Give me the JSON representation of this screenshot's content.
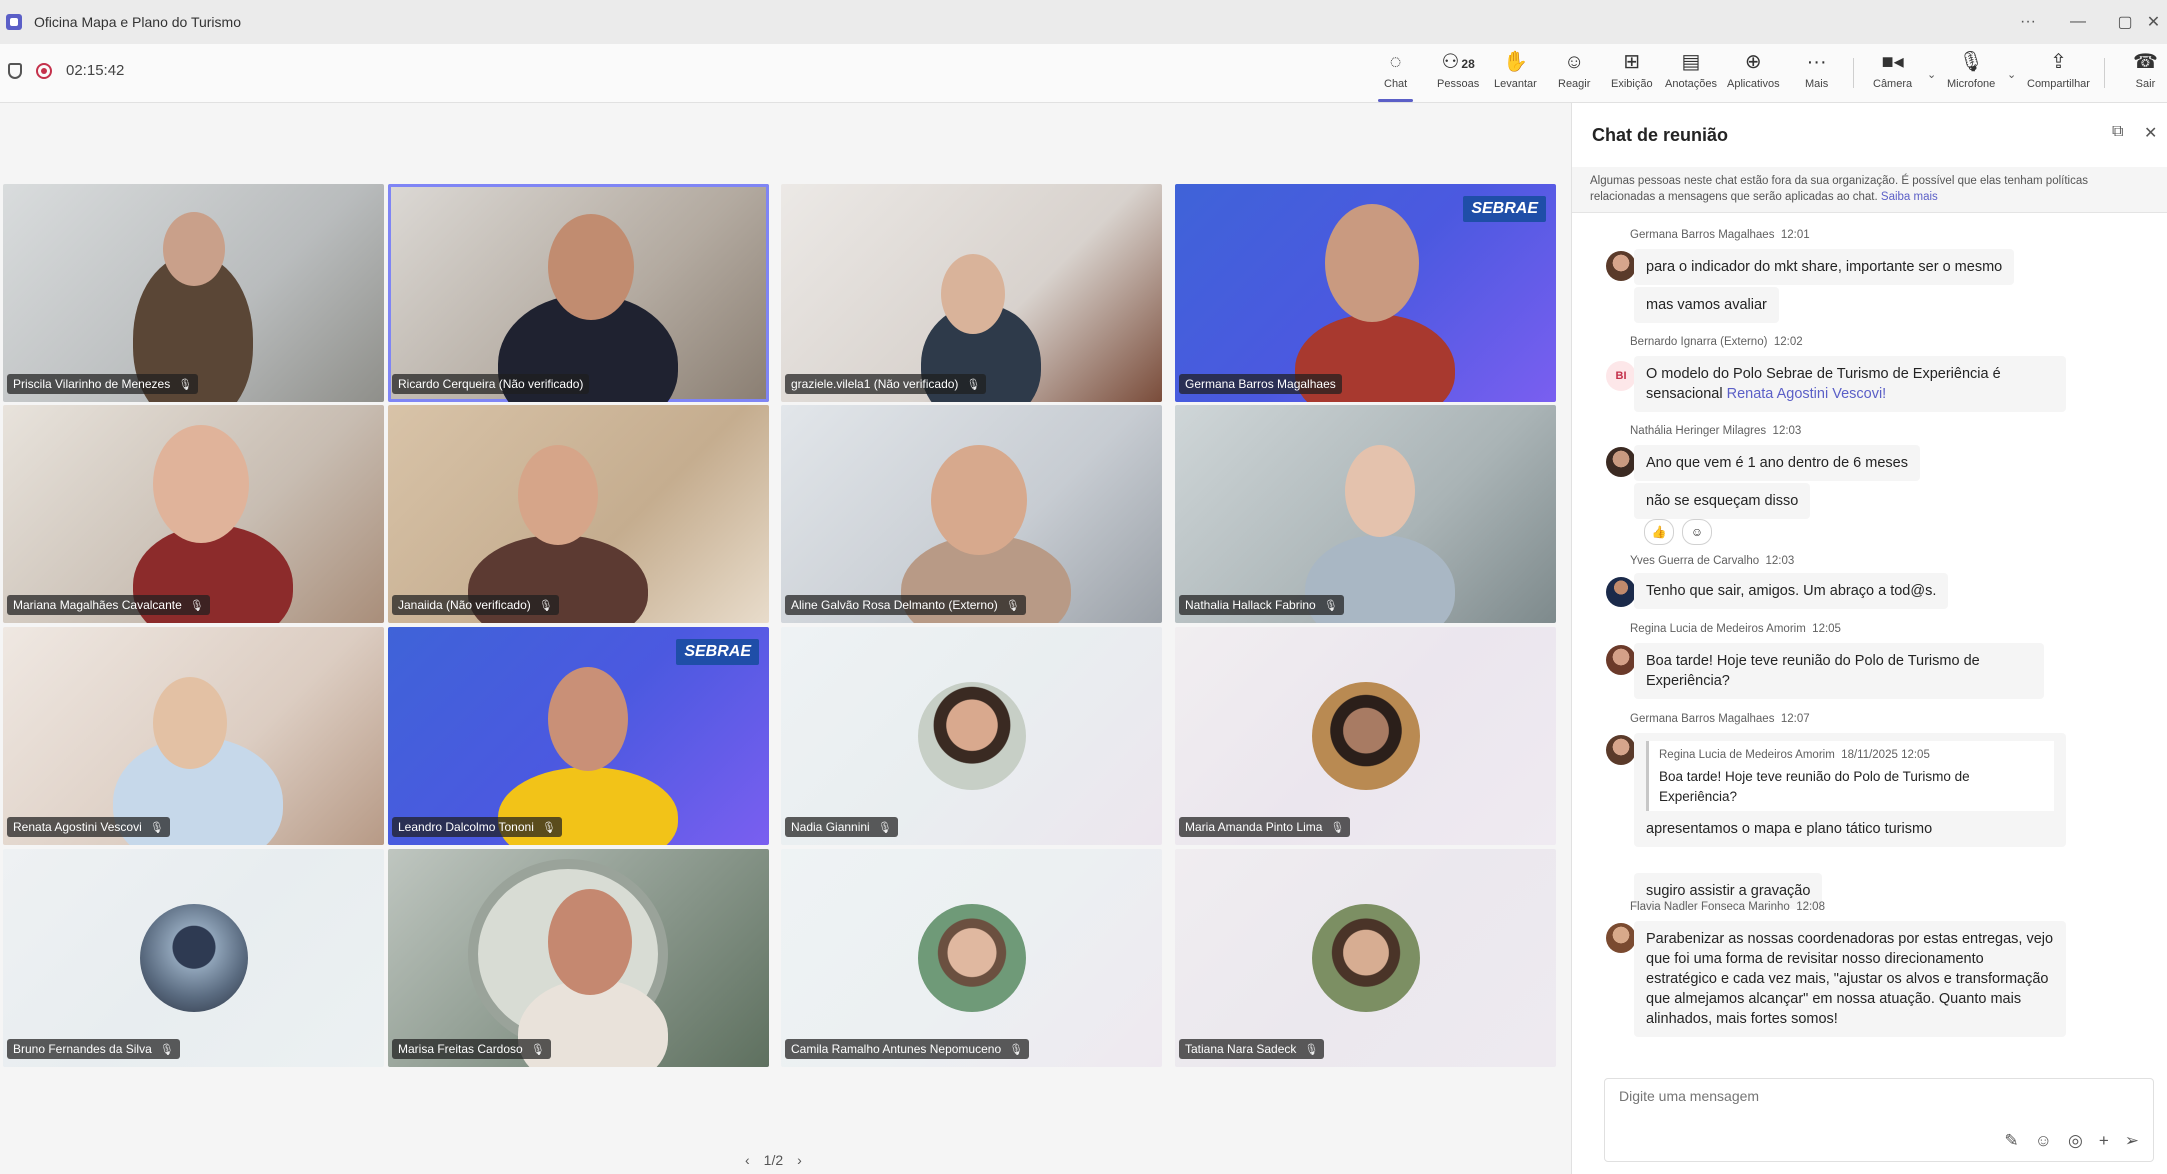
{
  "window": {
    "title": "Oficina Mapa e Plano do Turismo"
  },
  "meeting": {
    "elapsed": "02:15:42",
    "people_count": "28"
  },
  "toolbar": {
    "chat": "Chat",
    "people": "Pessoas",
    "raise": "Levantar",
    "react": "Reagir",
    "view": "Exibição",
    "notes": "Anotações",
    "apps": "Aplicativos",
    "more": "Mais",
    "camera": "Câmera",
    "mic": "Microfone",
    "share": "Compartilhar",
    "leave": "Sair"
  },
  "participants": [
    "Priscila Vilarinho de Menezes",
    "Ricardo Cerqueira (Não verificado)",
    "graziele.vilela1 (Não verificado)",
    "Germana Barros Magalhaes",
    "Mariana Magalhães Cavalcante",
    "Janaiida (Não verificado)",
    "Aline Galvão Rosa Delmanto (Externo)",
    "Nathalia Hallack Fabrino",
    "Renata Agostini Vescovi",
    "Leandro Dalcolmo Tononi",
    "Nadia Giannini",
    "Maria Amanda Pinto Lima",
    "Bruno Fernandes da Silva",
    "Marisa Freitas Cardoso",
    "Camila Ramalho Antunes Nepomuceno",
    "Tatiana Nara Sadeck"
  ],
  "brand": {
    "sebrae": "SEBRAE"
  },
  "pager": {
    "prev": "‹",
    "label": "1/2",
    "next": "›"
  },
  "chat": {
    "title": "Chat de reunião",
    "notice": "Algumas pessoas neste chat estão fora da sua organização. É possível que elas tenham políticas relacionadas a mensagens que serão aplicadas ao chat.",
    "notice_link": "Saiba mais",
    "messages": [
      {
        "sender": "Germana Barros Magalhaes",
        "time": "12:01",
        "lines": [
          "para o indicador do  mkt share, importante ser o mesmo",
          "mas vamos avaliar"
        ]
      },
      {
        "sender": "Bernardo Ignarra (Externo)",
        "time": "12:02",
        "initials": "BI",
        "text": "O modelo do Polo Sebrae  de Turismo de Experiência  é sensacional",
        "mention": "Renata Agostini Vescovi!"
      },
      {
        "sender": "Nathália Heringer Milagres",
        "time": "12:03",
        "lines": [
          "Ano que vem é 1 ano dentro de 6 meses",
          "não se esqueçam disso"
        ]
      },
      {
        "sender": "Yves Guerra de Carvalho",
        "time": "12:03",
        "text": "Tenho que sair, amigos. Um abraço a tod@s."
      },
      {
        "sender": "Regina Lucia de Medeiros Amorim",
        "time": "12:05",
        "text": "Boa tarde!     Hoje teve reunião do Polo de Turismo de Experiência?"
      },
      {
        "sender": "Germana Barros Magalhaes",
        "time": "12:07",
        "quote": {
          "sender": "Regina Lucia de Medeiros Amorim",
          "datetime": "18/11/2025 12:05",
          "text": "Boa tarde! Hoje teve reunião do Polo de Turismo de Experiência?"
        },
        "lines": [
          "apresentamos o mapa e plano tático turismo",
          "sugiro assistir a gravação"
        ]
      },
      {
        "sender": "Flavia Nadler Fonseca Marinho",
        "time": "12:08",
        "text": "Parabenizar as nossas coordenadoras por estas entregas, vejo que foi uma forma de revisitar nosso direcionamento estratégico e cada vez mais, \"ajustar os alvos e transformação que almejamos alcançar\" em nossa atuação. Quanto mais alinhados, mais fortes somos!"
      }
    ],
    "compose_placeholder": "Digite uma mensagem"
  },
  "colors": {
    "accent": "#5b5fc7",
    "record": "#c4314b",
    "leave": "#c4314b"
  }
}
